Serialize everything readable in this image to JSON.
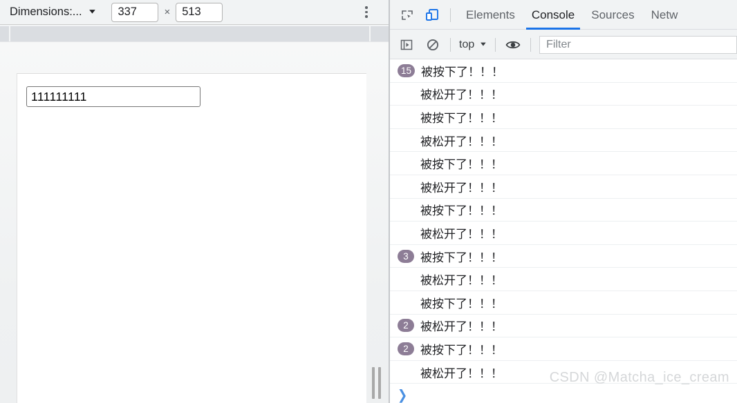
{
  "device_toolbar": {
    "dimensions_label": "Dimensions:...",
    "dimensions_caret": "▼",
    "width_value": "337",
    "multiply_symbol": "×",
    "height_value": "513",
    "more_options_name": "more-options"
  },
  "page": {
    "input_value": "111111111",
    "input_placeholder": ""
  },
  "devtools": {
    "tabs": [
      {
        "label": "Elements",
        "active": false
      },
      {
        "label": "Console",
        "active": true
      },
      {
        "label": "Sources",
        "active": false
      },
      {
        "label": "Netw",
        "active": false
      }
    ],
    "toolbar": {
      "inspect_icon": "inspect-element-icon",
      "device_toggle_icon": "device-toolbar-icon"
    },
    "console_toolbar": {
      "sidebar_icon": "console-sidebar-icon",
      "clear_icon": "clear-console-icon",
      "context_label": "top",
      "context_caret": "▼",
      "eye_icon": "live-expression-icon",
      "filter_placeholder": "Filter",
      "filter_value": ""
    },
    "messages": [
      {
        "count": "15",
        "text": "被按下了！！！"
      },
      {
        "count": "",
        "text": "被松开了！！！"
      },
      {
        "count": "",
        "text": "被按下了！！！"
      },
      {
        "count": "",
        "text": "被松开了！！！"
      },
      {
        "count": "",
        "text": "被按下了！！！"
      },
      {
        "count": "",
        "text": "被松开了！！！"
      },
      {
        "count": "",
        "text": "被按下了！！！"
      },
      {
        "count": "",
        "text": "被松开了！！！"
      },
      {
        "count": "3",
        "text": "被按下了！！！"
      },
      {
        "count": "",
        "text": "被松开了！！！"
      },
      {
        "count": "",
        "text": "被按下了！！！"
      },
      {
        "count": "2",
        "text": "被松开了！！！"
      },
      {
        "count": "2",
        "text": "被按下了！！！"
      },
      {
        "count": "",
        "text": "被松开了！！！"
      }
    ],
    "prompt_symbol": "❯"
  },
  "watermark": "CSDN @Matcha_ice_cream",
  "colors": {
    "accent": "#1a73e8",
    "badge": "#8d7d96",
    "toolbar_bg": "#f1f3f4",
    "prompt": "#4a90e2"
  }
}
